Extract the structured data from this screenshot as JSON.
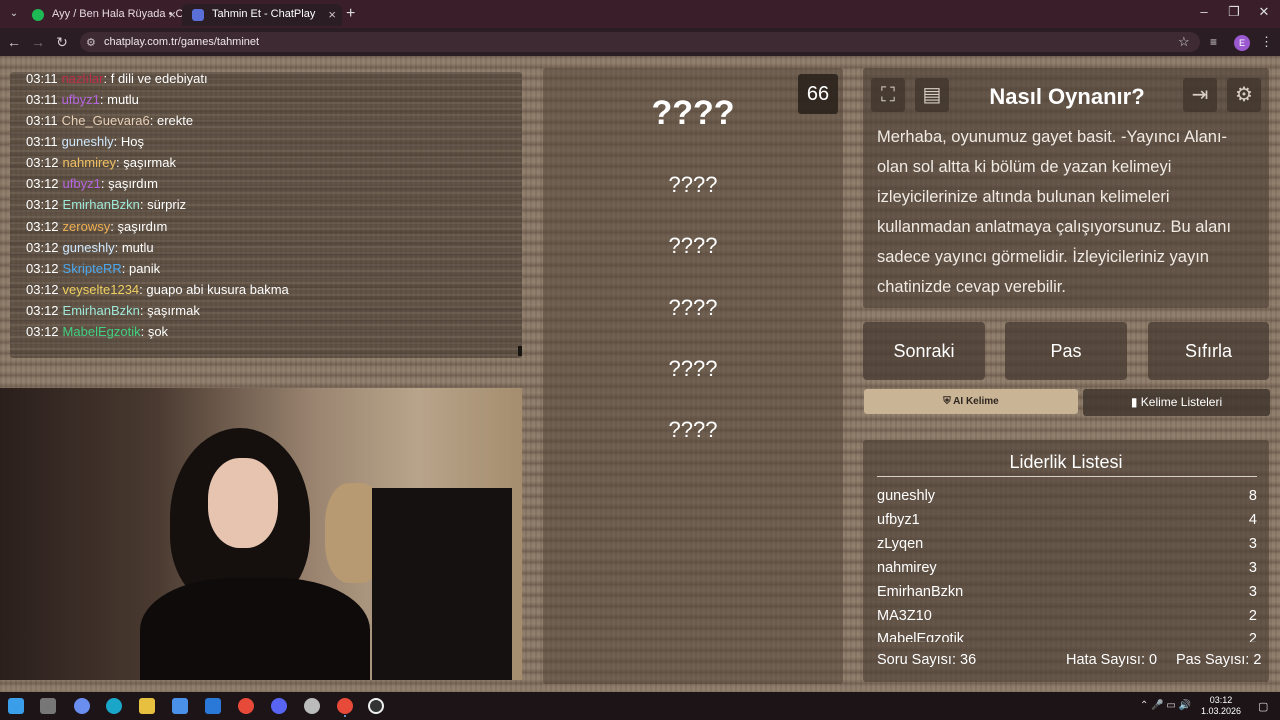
{
  "browser": {
    "tabs": [
      {
        "title": "Ayy / Ben Hala Rüyada • Op",
        "active": false
      },
      {
        "title": "Tahmin Et - ChatPlay",
        "active": true
      }
    ],
    "new_tab": "+",
    "url": "chatplay.com.tr/games/tahminet",
    "profile": "E"
  },
  "chat": {
    "messages": [
      {
        "time": "03:11",
        "user": "nazlılar",
        "text": ": f dili ve edebiyatı",
        "color": "#c0304a"
      },
      {
        "time": "03:11",
        "user": "ufbyz1",
        "text": ": mutlu",
        "color": "#b565e0"
      },
      {
        "time": "03:11",
        "user": "Che_Guevara6",
        "text": ": erekte",
        "color": "#e8d0b8"
      },
      {
        "time": "03:11",
        "user": "guneshly",
        "text": ": Hoş",
        "color": "#cfe8ff"
      },
      {
        "time": "03:12",
        "user": "nahmirey",
        "text": ": şaşırmak",
        "color": "#f0c060"
      },
      {
        "time": "03:12",
        "user": "ufbyz1",
        "text": ": şaşırdım",
        "color": "#b565e0"
      },
      {
        "time": "03:12",
        "user": "EmirhanBzkn",
        "text": ": sürpriz",
        "color": "#9ee8d8"
      },
      {
        "time": "03:12",
        "user": "zerowsy",
        "text": ": şaşırdım",
        "color": "#f0b050"
      },
      {
        "time": "03:12",
        "user": "guneshly",
        "text": ": mutlu",
        "color": "#cfe8ff"
      },
      {
        "time": "03:12",
        "user": "SkripteRR",
        "text": ": panik",
        "color": "#4aa8f0"
      },
      {
        "time": "03:12",
        "user": "veyselte1234",
        "text": ": guapo abi kusura bakma",
        "color": "#f0d060"
      },
      {
        "time": "03:12",
        "user": "EmirhanBzkn",
        "text": ": şaşırmak",
        "color": "#9ee8d8"
      },
      {
        "time": "03:12",
        "user": "MabelEgzotik",
        "text": ": şok",
        "color": "#40d080"
      }
    ]
  },
  "game": {
    "timer": "66",
    "main_word": "????",
    "forbidden_words": [
      "????",
      "????",
      "????",
      "????",
      "????"
    ]
  },
  "howto": {
    "title": "Nasıl Oynanır?",
    "body": "Merhaba, oyunumuz gayet basit. -Yayıncı Alanı- olan sol altta ki bölüm de yazan kelimeyi izleyicilerinize altında bulunan kelimeleri kullanmadan anlatmaya çalışıyorsunuz. Bu alanı sadece yayıncı görmelidir. İzleyicileriniz yayın chatinizde cevap verebilir.",
    "icons": [
      "fullscreen-icon",
      "document-icon",
      "exit-icon",
      "settings-icon"
    ]
  },
  "actions": {
    "next": "Sonraki",
    "pass": "Pas",
    "reset": "Sıfırla",
    "ai_word": "AI Kelime",
    "word_lists": "Kelime Listeleri"
  },
  "leaderboard": {
    "title": "Liderlik Listesi",
    "rows": [
      {
        "name": "guneshly",
        "score": "8"
      },
      {
        "name": "ufbyz1",
        "score": "4"
      },
      {
        "name": "zLyqen",
        "score": "3"
      },
      {
        "name": "nahmirey",
        "score": "3"
      },
      {
        "name": "EmirhanBzkn",
        "score": "3"
      },
      {
        "name": "MA3Z10",
        "score": "2"
      },
      {
        "name": "MabelEgzotik",
        "score": "2"
      }
    ]
  },
  "stats": {
    "questions": "Soru Sayısı: 36",
    "errors": "Hata Sayısı: 0",
    "passes": "Pas Sayısı: 2"
  },
  "taskbar": {
    "time": "03:12",
    "date": "1.03.2026"
  }
}
